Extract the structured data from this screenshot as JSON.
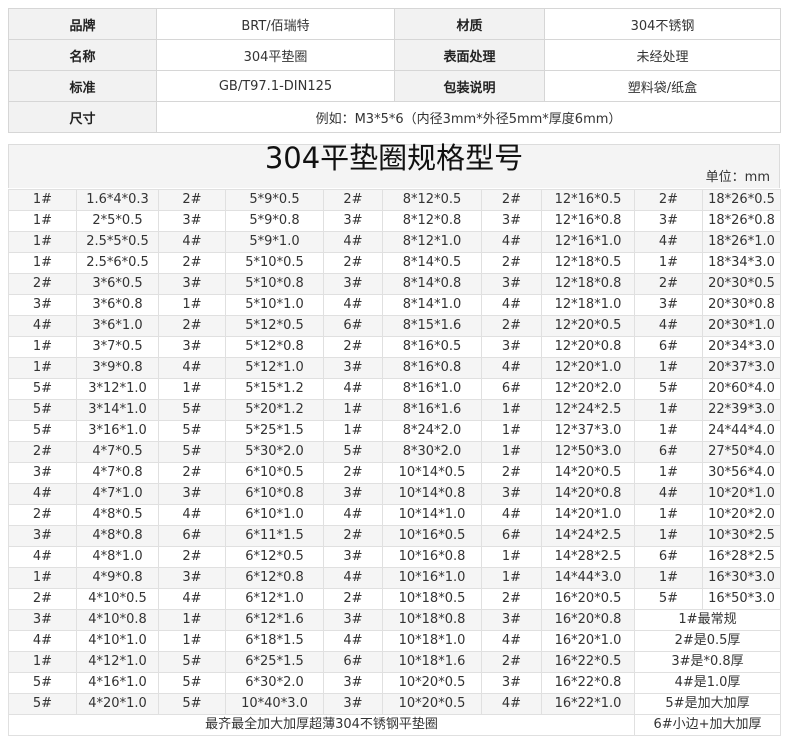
{
  "attributes": [
    {
      "k1": "品牌",
      "v1": "BRT/佰瑞特",
      "k2": "材质",
      "v2": "304不锈钢"
    },
    {
      "k1": "名称",
      "v1": "304平垫圈",
      "k2": "表面处理",
      "v2": "未经处理"
    },
    {
      "k1": "标准",
      "v1": "GB/T97.1-DIN125",
      "k2": "包装说明",
      "v2": "塑料袋/纸盒"
    }
  ],
  "size": {
    "label": "尺寸",
    "value": "例如：M3*5*6（内径3mm*外径5mm*厚度6mm）"
  },
  "spec_title": "304平垫圈规格型号",
  "unit": "单位：mm",
  "rows": [
    [
      "1#",
      "1.6*4*0.3",
      "2#",
      "5*9*0.5",
      "2#",
      "8*12*0.5",
      "2#",
      "12*16*0.5",
      "2#",
      "18*26*0.5"
    ],
    [
      "1#",
      "2*5*0.5",
      "3#",
      "5*9*0.8",
      "3#",
      "8*12*0.8",
      "3#",
      "12*16*0.8",
      "3#",
      "18*26*0.8"
    ],
    [
      "1#",
      "2.5*5*0.5",
      "4#",
      "5*9*1.0",
      "4#",
      "8*12*1.0",
      "4#",
      "12*16*1.0",
      "4#",
      "18*26*1.0"
    ],
    [
      "1#",
      "2.5*6*0.5",
      "2#",
      "5*10*0.5",
      "2#",
      "8*14*0.5",
      "2#",
      "12*18*0.5",
      "1#",
      "18*34*3.0"
    ],
    [
      "2#",
      "3*6*0.5",
      "3#",
      "5*10*0.8",
      "3#",
      "8*14*0.8",
      "3#",
      "12*18*0.8",
      "2#",
      "20*30*0.5"
    ],
    [
      "3#",
      "3*6*0.8",
      "1#",
      "5*10*1.0",
      "4#",
      "8*14*1.0",
      "4#",
      "12*18*1.0",
      "3#",
      "20*30*0.8"
    ],
    [
      "4#",
      "3*6*1.0",
      "2#",
      "5*12*0.5",
      "6#",
      "8*15*1.6",
      "2#",
      "12*20*0.5",
      "4#",
      "20*30*1.0"
    ],
    [
      "1#",
      "3*7*0.5",
      "3#",
      "5*12*0.8",
      "2#",
      "8*16*0.5",
      "3#",
      "12*20*0.8",
      "6#",
      "20*34*3.0"
    ],
    [
      "1#",
      "3*9*0.8",
      "4#",
      "5*12*1.0",
      "3#",
      "8*16*0.8",
      "4#",
      "12*20*1.0",
      "1#",
      "20*37*3.0"
    ],
    [
      "5#",
      "3*12*1.0",
      "1#",
      "5*15*1.2",
      "4#",
      "8*16*1.0",
      "6#",
      "12*20*2.0",
      "5#",
      "20*60*4.0"
    ],
    [
      "5#",
      "3*14*1.0",
      "5#",
      "5*20*1.2",
      "1#",
      "8*16*1.6",
      "1#",
      "12*24*2.5",
      "1#",
      "22*39*3.0"
    ],
    [
      "5#",
      "3*16*1.0",
      "5#",
      "5*25*1.5",
      "1#",
      "8*24*2.0",
      "1#",
      "12*37*3.0",
      "1#",
      "24*44*4.0"
    ],
    [
      "2#",
      "4*7*0.5",
      "5#",
      "5*30*2.0",
      "5#",
      "8*30*2.0",
      "1#",
      "12*50*3.0",
      "6#",
      "27*50*4.0"
    ],
    [
      "3#",
      "4*7*0.8",
      "2#",
      "6*10*0.5",
      "2#",
      "10*14*0.5",
      "2#",
      "14*20*0.5",
      "1#",
      "30*56*4.0"
    ],
    [
      "4#",
      "4*7*1.0",
      "3#",
      "6*10*0.8",
      "3#",
      "10*14*0.8",
      "3#",
      "14*20*0.8",
      "4#",
      "10*20*1.0"
    ],
    [
      "2#",
      "4*8*0.5",
      "4#",
      "6*10*1.0",
      "4#",
      "10*14*1.0",
      "4#",
      "14*20*1.0",
      "1#",
      "10*20*2.0"
    ],
    [
      "3#",
      "4*8*0.8",
      "6#",
      "6*11*1.5",
      "2#",
      "10*16*0.5",
      "6#",
      "14*24*2.5",
      "1#",
      "10*30*2.5"
    ],
    [
      "4#",
      "4*8*1.0",
      "2#",
      "6*12*0.5",
      "3#",
      "10*16*0.8",
      "1#",
      "14*28*2.5",
      "6#",
      "16*28*2.5"
    ],
    [
      "1#",
      "4*9*0.8",
      "3#",
      "6*12*0.8",
      "4#",
      "10*16*1.0",
      "1#",
      "14*44*3.0",
      "1#",
      "16*30*3.0"
    ],
    [
      "2#",
      "4*10*0.5",
      "4#",
      "6*12*1.0",
      "2#",
      "10*18*0.5",
      "2#",
      "16*20*0.5",
      "5#",
      "16*50*3.0"
    ],
    [
      "3#",
      "4*10*0.8",
      "1#",
      "6*12*1.6",
      "3#",
      "10*18*0.8",
      "3#",
      "16*20*0.8",
      "1#最常规"
    ],
    [
      "4#",
      "4*10*1.0",
      "1#",
      "6*18*1.5",
      "4#",
      "10*18*1.0",
      "4#",
      "16*20*1.0",
      "2#是0.5厚"
    ],
    [
      "1#",
      "4*12*1.0",
      "5#",
      "6*25*1.5",
      "6#",
      "10*18*1.6",
      "2#",
      "16*22*0.5",
      "3#是*0.8厚"
    ],
    [
      "5#",
      "4*16*1.0",
      "5#",
      "6*30*2.0",
      "3#",
      "10*20*0.5",
      "3#",
      "16*22*0.8",
      "4#是1.0厚"
    ],
    [
      "5#",
      "4*20*1.0",
      "5#",
      "10*40*3.0",
      "3#",
      "10*20*0.5",
      "4#",
      "16*22*1.0",
      "5#是加大加厚"
    ]
  ],
  "footer": {
    "left": "最齐最全加大加厚超薄304不锈钢平垫圈",
    "right": "6#小边+加大加厚"
  }
}
